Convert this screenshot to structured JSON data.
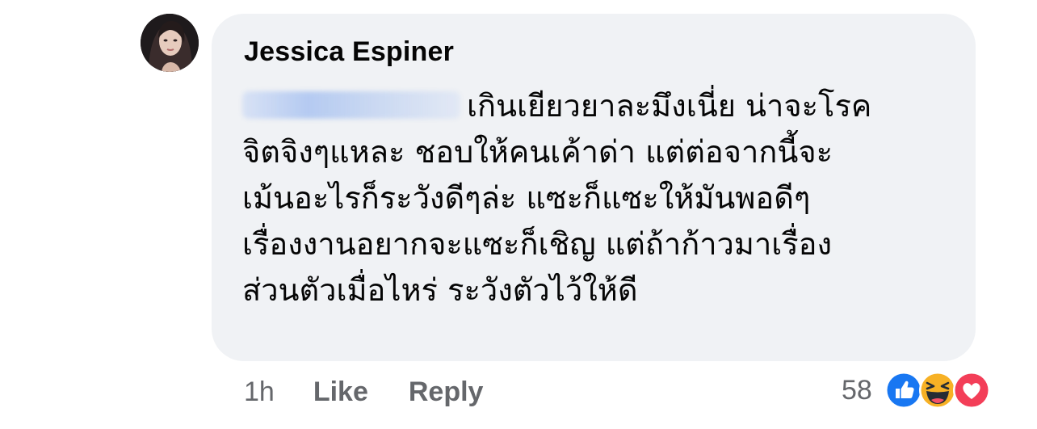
{
  "comment": {
    "author": "Jessica Espiner",
    "lines": [
      "เกินเยียวยาละมึงเนี่ย น่าจะโรค",
      "จิตจิงๆแหละ ชอบให้คนเค้าด่า แต่ต่อจากนี้จะ",
      "เม้นอะไรก็ระวังดีๆล่ะ แซะก็แซะให้มันพอดีๆ",
      "เรื่องงานอยากจะแซะก็เชิญ แต่ถ้าก้าวมาเรื่อง",
      "ส่วนตัวเมื่อไหร่ ระวังตัวไว้ให้ดี"
    ]
  },
  "actions": {
    "time": "1h",
    "like_label": "Like",
    "reply_label": "Reply"
  },
  "reactions": {
    "count": "58",
    "icons": [
      "like-reaction-icon",
      "haha-reaction-icon",
      "love-reaction-icon"
    ]
  },
  "colors": {
    "bubble": "#f0f2f5",
    "text": "#050505",
    "secondary": "#65676b",
    "like_blue": "#1877f2",
    "love_red": "#f33e58",
    "haha_yellow": "#f7b125"
  }
}
